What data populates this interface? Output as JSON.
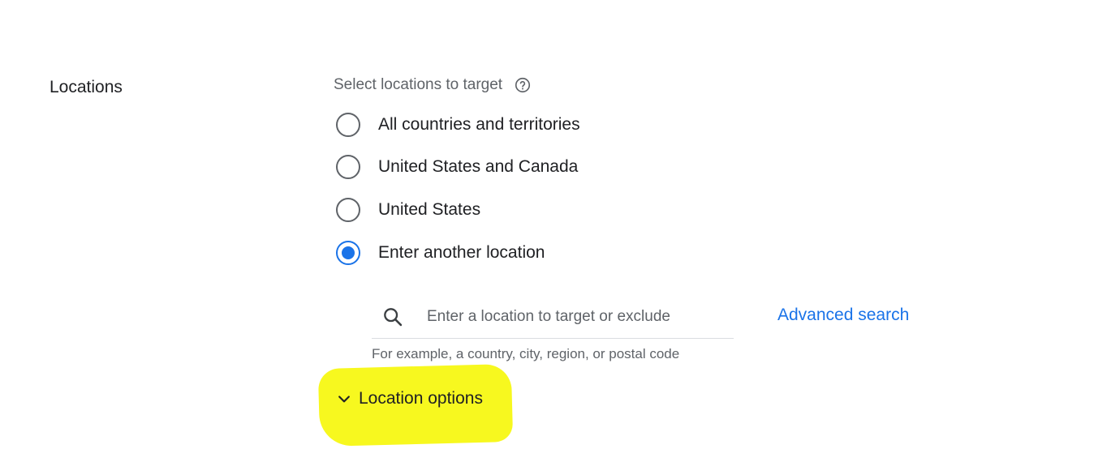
{
  "section": {
    "label": "Locations"
  },
  "targeting": {
    "prompt": "Select locations to target",
    "help_icon": "help-circle-icon",
    "options": [
      {
        "label": "All countries and territories",
        "selected": false
      },
      {
        "label": "United States and Canada",
        "selected": false
      },
      {
        "label": "United States",
        "selected": false
      },
      {
        "label": "Enter another location",
        "selected": true
      }
    ]
  },
  "search": {
    "icon": "search-icon",
    "placeholder": "Enter a location to target or exclude",
    "value": "",
    "hint": "For example, a country, city, region, or postal code",
    "advanced_label": "Advanced search"
  },
  "location_options": {
    "icon": "chevron-down-icon",
    "label": "Location options",
    "highlight_color": "#f7f81f"
  },
  "colors": {
    "accent": "#1a73e8",
    "text": "#202124",
    "secondary_text": "#5f6368",
    "divider": "#dadce0"
  }
}
